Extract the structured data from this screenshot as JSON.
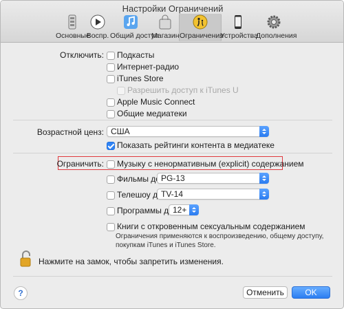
{
  "window": {
    "title": "Настройки Ограничений"
  },
  "tabs": [
    {
      "label": "Основные",
      "icon": "phone-switch-icon"
    },
    {
      "label": "Воспр.",
      "icon": "play-icon"
    },
    {
      "label": "Общий доступ",
      "icon": "music-note-icon"
    },
    {
      "label": "Магазин",
      "icon": "shopping-bag-icon"
    },
    {
      "label": "Ограничения",
      "icon": "parental-controls-icon",
      "active": true
    },
    {
      "label": "Устройства",
      "icon": "iphone-icon"
    },
    {
      "label": "Дополнения",
      "icon": "gear-icon"
    }
  ],
  "disable": {
    "label": "Отключить:",
    "items": [
      {
        "label": "Подкасты",
        "checked": false,
        "enabled": true
      },
      {
        "label": "Интернет-радио",
        "checked": false,
        "enabled": true
      },
      {
        "label": "iTunes Store",
        "checked": false,
        "enabled": true
      },
      {
        "label": "Разрешить доступ к iTunes U",
        "checked": false,
        "enabled": false
      },
      {
        "label": "Apple Music Connect",
        "checked": false,
        "enabled": true
      },
      {
        "label": "Общие медиатеки",
        "checked": false,
        "enabled": true
      }
    ]
  },
  "rating": {
    "label": "Возрастной ценз:",
    "country": "США",
    "show_ratings_label": "Показать рейтинги контента в медиатеке",
    "show_ratings_checked": true
  },
  "restrict": {
    "label": "Ограничить:",
    "explicit_music_label": "Музыку с ненормативным (explicit) содержанием",
    "explicit_music_checked": false,
    "movies_label": "Фильмы до",
    "movies_value": "PG-13",
    "tv_label": "Телешоу до",
    "tv_value": "TV-14",
    "apps_label": "Программы до",
    "apps_value": "12+",
    "books_label": "Книги с откровенным сексуальным содержанием",
    "note": "Ограничения применяются к воспроизведению, общему доступу, покупкам iTunes и iTunes Store."
  },
  "lock": {
    "label": "Нажмите на замок, чтобы запретить изменения."
  },
  "buttons": {
    "cancel": "Отменить",
    "ok": "OK",
    "help": "?"
  },
  "colors": {
    "accent": "#2f83f5",
    "highlight_border": "#e0393e",
    "lock": "#e2a526"
  }
}
